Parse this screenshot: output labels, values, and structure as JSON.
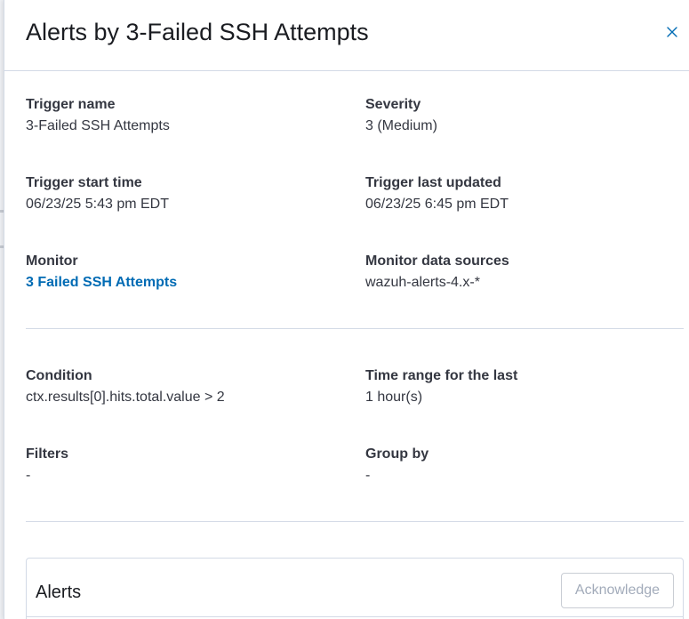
{
  "flyout": {
    "title": "Alerts by 3-Failed SSH Attempts",
    "close_icon": "close-icon"
  },
  "details": {
    "trigger_name": {
      "label": "Trigger name",
      "value": "3-Failed SSH Attempts"
    },
    "severity": {
      "label": "Severity",
      "value": "3 (Medium)"
    },
    "trigger_start_time": {
      "label": "Trigger start time",
      "value": "06/23/25 5:43 pm EDT"
    },
    "trigger_last_updated": {
      "label": "Trigger last updated",
      "value": "06/23/25 6:45 pm EDT"
    },
    "monitor": {
      "label": "Monitor",
      "value": "3 Failed SSH Attempts"
    },
    "monitor_data_sources": {
      "label": "Monitor data sources",
      "value": "wazuh-alerts-4.x-*"
    }
  },
  "conditions": {
    "condition": {
      "label": "Condition",
      "value": "ctx.results[0].hits.total.value > 2"
    },
    "time_range": {
      "label": "Time range for the last",
      "value": "1 hour(s)"
    },
    "filters": {
      "label": "Filters",
      "value": "-"
    },
    "group_by": {
      "label": "Group by",
      "value": "-"
    }
  },
  "alerts_panel": {
    "title": "Alerts",
    "acknowledge_label": "Acknowledge"
  },
  "colors": {
    "link": "#006bb4",
    "text": "#343741",
    "border": "#d3dae6",
    "disabled_text": "#a2abba"
  }
}
